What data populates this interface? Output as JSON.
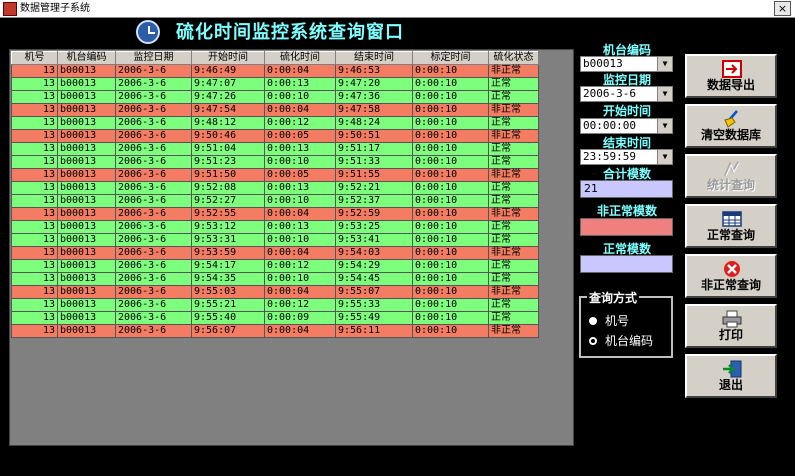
{
  "window": {
    "title": "数据管理子系统",
    "close_glyph": "×"
  },
  "app_title": "硫化时间监控系统查询窗口",
  "grid": {
    "columns": [
      "机号",
      "机台编码",
      "监控日期",
      "开始时间",
      "硫化时间",
      "结束时间",
      "标定时间",
      "硫化状态"
    ],
    "rows": [
      [
        "13",
        "b00013",
        "2006-3-6",
        "9:46:49",
        "0:00:04",
        "9:46:53",
        "0:00:10",
        "非正常"
      ],
      [
        "13",
        "b00013",
        "2006-3-6",
        "9:47:07",
        "0:00:13",
        "9:47:20",
        "0:00:10",
        "正常"
      ],
      [
        "13",
        "b00013",
        "2006-3-6",
        "9:47:26",
        "0:00:10",
        "9:47:36",
        "0:00:10",
        "正常"
      ],
      [
        "13",
        "b00013",
        "2006-3-6",
        "9:47:54",
        "0:00:04",
        "9:47:58",
        "0:00:10",
        "非正常"
      ],
      [
        "13",
        "b00013",
        "2006-3-6",
        "9:48:12",
        "0:00:12",
        "9:48:24",
        "0:00:10",
        "正常"
      ],
      [
        "13",
        "b00013",
        "2006-3-6",
        "9:50:46",
        "0:00:05",
        "9:50:51",
        "0:00:10",
        "非正常"
      ],
      [
        "13",
        "b00013",
        "2006-3-6",
        "9:51:04",
        "0:00:13",
        "9:51:17",
        "0:00:10",
        "正常"
      ],
      [
        "13",
        "b00013",
        "2006-3-6",
        "9:51:23",
        "0:00:10",
        "9:51:33",
        "0:00:10",
        "正常"
      ],
      [
        "13",
        "b00013",
        "2006-3-6",
        "9:51:50",
        "0:00:05",
        "9:51:55",
        "0:00:10",
        "非正常"
      ],
      [
        "13",
        "b00013",
        "2006-3-6",
        "9:52:08",
        "0:00:13",
        "9:52:21",
        "0:00:10",
        "正常"
      ],
      [
        "13",
        "b00013",
        "2006-3-6",
        "9:52:27",
        "0:00:10",
        "9:52:37",
        "0:00:10",
        "正常"
      ],
      [
        "13",
        "b00013",
        "2006-3-6",
        "9:52:55",
        "0:00:04",
        "9:52:59",
        "0:00:10",
        "非正常"
      ],
      [
        "13",
        "b00013",
        "2006-3-6",
        "9:53:12",
        "0:00:13",
        "9:53:25",
        "0:00:10",
        "正常"
      ],
      [
        "13",
        "b00013",
        "2006-3-6",
        "9:53:31",
        "0:00:10",
        "9:53:41",
        "0:00:10",
        "正常"
      ],
      [
        "13",
        "b00013",
        "2006-3-6",
        "9:53:59",
        "0:00:04",
        "9:54:03",
        "0:00:10",
        "非正常"
      ],
      [
        "13",
        "b00013",
        "2006-3-6",
        "9:54:17",
        "0:00:12",
        "9:54:29",
        "0:00:10",
        "正常"
      ],
      [
        "13",
        "b00013",
        "2006-3-6",
        "9:54:35",
        "0:00:10",
        "9:54:45",
        "0:00:10",
        "正常"
      ],
      [
        "13",
        "b00013",
        "2006-3-6",
        "9:55:03",
        "0:00:04",
        "9:55:07",
        "0:00:10",
        "非正常"
      ],
      [
        "13",
        "b00013",
        "2006-3-6",
        "9:55:21",
        "0:00:12",
        "9:55:33",
        "0:00:10",
        "正常"
      ],
      [
        "13",
        "b00013",
        "2006-3-6",
        "9:55:40",
        "0:00:09",
        "9:55:49",
        "0:00:10",
        "正常"
      ],
      [
        "13",
        "b00013",
        "2006-3-6",
        "9:56:07",
        "0:00:04",
        "9:56:11",
        "0:00:10",
        "非正常"
      ]
    ]
  },
  "filters": {
    "machine_code_label": "机台编码",
    "machine_code_value": "b00013",
    "monitor_date_label": "监控日期",
    "monitor_date_value": "2006-3-6",
    "start_time_label": "开始时间",
    "start_time_value": "00:00:00",
    "end_time_label": "结束时间",
    "end_time_value": "23:59:59",
    "total_label": "合计模数",
    "total_value": "21",
    "abnormal_label": "非正常模数",
    "abnormal_value": "",
    "normal_label": "正常模数",
    "normal_value": ""
  },
  "query_mode": {
    "label": "查询方式",
    "options": [
      "机号",
      "机台编码"
    ],
    "selected": "机台编码"
  },
  "buttons": {
    "export": "数据导出",
    "clear_db": "清空数据库",
    "stats_query": "统计查询",
    "normal_query": "正常查询",
    "abnormal_query": "非正常查询",
    "print": "打印",
    "exit": "退出"
  },
  "colors": {
    "normal_row": "#7dff7d",
    "abnormal_row": "#f47c62",
    "title_text": "#7fffff",
    "total_field": "#c8c8ff",
    "abnormal_field": "#f08080",
    "normal_field": "#c8c8ff"
  }
}
